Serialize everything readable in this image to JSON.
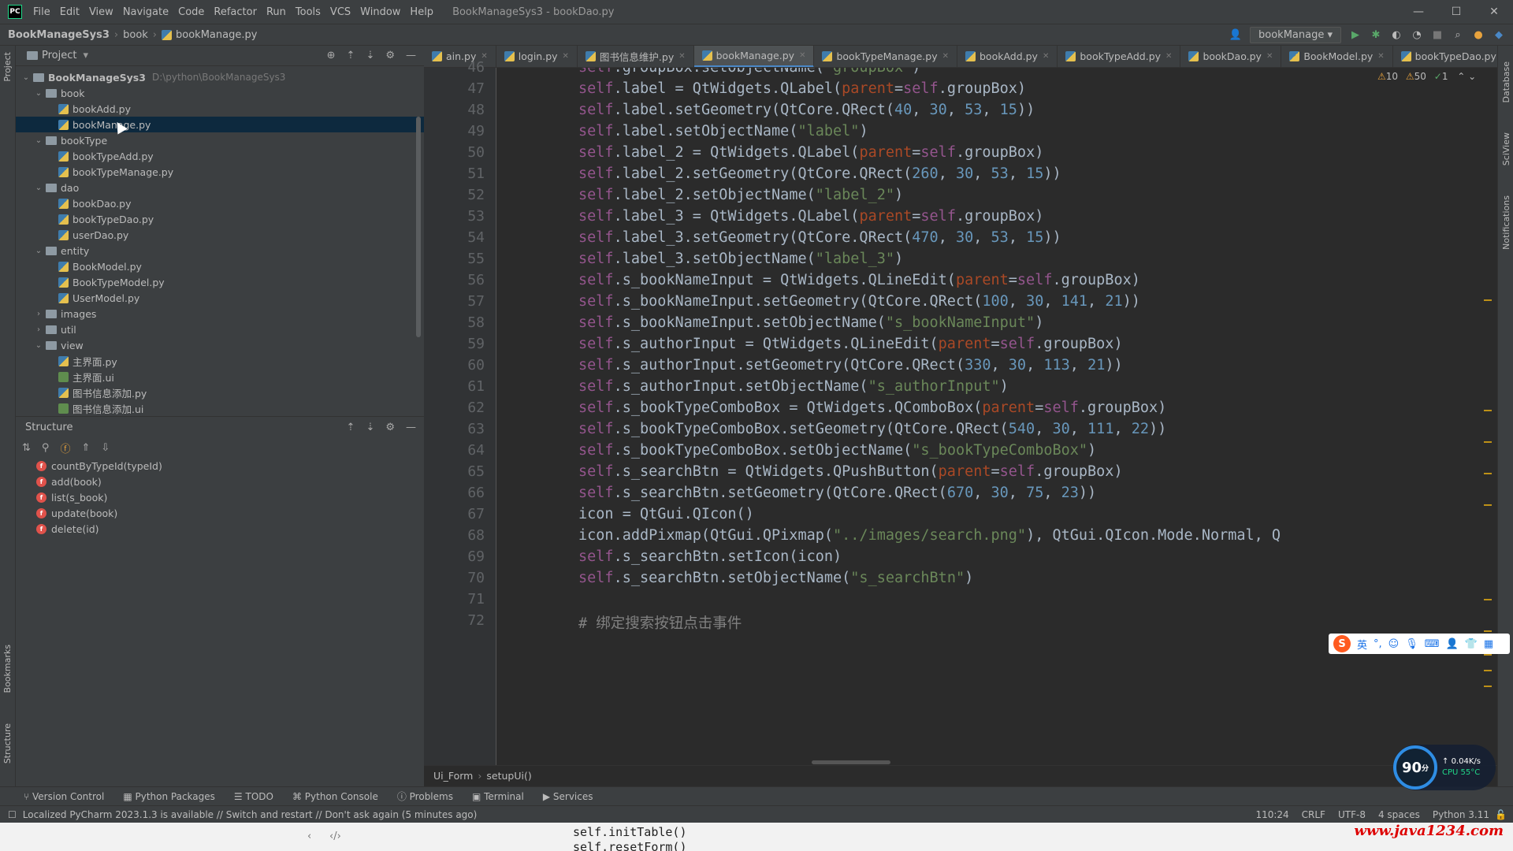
{
  "app": {
    "logo": "PC",
    "window_title": "BookManageSys3 - bookDao.py",
    "menu": [
      "File",
      "Edit",
      "View",
      "Navigate",
      "Code",
      "Refactor",
      "Run",
      "Tools",
      "VCS",
      "Window",
      "Help"
    ]
  },
  "navbar": {
    "crumbs": [
      "BookManageSys3",
      "book",
      "bookManage.py"
    ],
    "run_config": "bookManage"
  },
  "left_stripe": {
    "project": "Project",
    "bookmarks": "Bookmarks",
    "structure": "Structure"
  },
  "right_stripe": {
    "database": "Database",
    "sciview": "SciView",
    "notifications": "Notifications"
  },
  "project_panel": {
    "title": "Project",
    "root_name": "BookManageSys3",
    "root_path": "D:\\python\\BookManageSys3",
    "tree": [
      {
        "label": "book",
        "type": "folder",
        "open": true
      },
      {
        "label": "bookAdd.py",
        "type": "py"
      },
      {
        "label": "bookManage.py",
        "type": "py",
        "selected": true
      },
      {
        "label": "bookType",
        "type": "folder",
        "open": true
      },
      {
        "label": "bookTypeAdd.py",
        "type": "py"
      },
      {
        "label": "bookTypeManage.py",
        "type": "py"
      },
      {
        "label": "dao",
        "type": "folder",
        "open": true
      },
      {
        "label": "bookDao.py",
        "type": "py"
      },
      {
        "label": "bookTypeDao.py",
        "type": "py"
      },
      {
        "label": "userDao.py",
        "type": "py"
      },
      {
        "label": "entity",
        "type": "folder",
        "open": true
      },
      {
        "label": "BookModel.py",
        "type": "py"
      },
      {
        "label": "BookTypeModel.py",
        "type": "py"
      },
      {
        "label": "UserModel.py",
        "type": "py"
      },
      {
        "label": "images",
        "type": "folder",
        "open": false
      },
      {
        "label": "util",
        "type": "folder",
        "open": false
      },
      {
        "label": "view",
        "type": "folder",
        "open": true
      },
      {
        "label": "主界面.py",
        "type": "py"
      },
      {
        "label": "主界面.ui",
        "type": "ui"
      },
      {
        "label": "图书信息添加.py",
        "type": "py"
      },
      {
        "label": "图书信息添加.ui",
        "type": "ui"
      }
    ]
  },
  "structure_panel": {
    "title": "Structure",
    "items": [
      "countByTypeId(typeId)",
      "add(book)",
      "list(s_book)",
      "update(book)",
      "delete(id)"
    ]
  },
  "tabs": [
    {
      "label": "ain.py",
      "active": false
    },
    {
      "label": "login.py",
      "active": false
    },
    {
      "label": "图书信息维护.py",
      "active": false
    },
    {
      "label": "bookManage.py",
      "active": true
    },
    {
      "label": "bookTypeManage.py",
      "active": false
    },
    {
      "label": "bookAdd.py",
      "active": false
    },
    {
      "label": "bookTypeAdd.py",
      "active": false
    },
    {
      "label": "bookDao.py",
      "active": false
    },
    {
      "label": "BookModel.py",
      "active": false
    },
    {
      "label": "bookTypeDao.py",
      "active": false
    }
  ],
  "inspections": {
    "warnings": "10",
    "weak_warnings": "50",
    "typos": "1"
  },
  "code": {
    "first_line": 46,
    "lines": [
      "self.groupBox.setObjectName(\"groupBox\")",
      "self.label = QtWidgets.QLabel(parent=self.groupBox)",
      "self.label.setGeometry(QtCore.QRect(40, 30, 53, 15))",
      "self.label.setObjectName(\"label\")",
      "self.label_2 = QtWidgets.QLabel(parent=self.groupBox)",
      "self.label_2.setGeometry(QtCore.QRect(260, 30, 53, 15))",
      "self.label_2.setObjectName(\"label_2\")",
      "self.label_3 = QtWidgets.QLabel(parent=self.groupBox)",
      "self.label_3.setGeometry(QtCore.QRect(470, 30, 53, 15))",
      "self.label_3.setObjectName(\"label_3\")",
      "self.s_bookNameInput = QtWidgets.QLineEdit(parent=self.groupBox)",
      "self.s_bookNameInput.setGeometry(QtCore.QRect(100, 30, 141, 21))",
      "self.s_bookNameInput.setObjectName(\"s_bookNameInput\")",
      "self.s_authorInput = QtWidgets.QLineEdit(parent=self.groupBox)",
      "self.s_authorInput.setGeometry(QtCore.QRect(330, 30, 113, 21))",
      "self.s_authorInput.setObjectName(\"s_authorInput\")",
      "self.s_bookTypeComboBox = QtWidgets.QComboBox(parent=self.groupBox)",
      "self.s_bookTypeComboBox.setGeometry(QtCore.QRect(540, 30, 111, 22))",
      "self.s_bookTypeComboBox.setObjectName(\"s_bookTypeComboBox\")",
      "self.s_searchBtn = QtWidgets.QPushButton(parent=self.groupBox)",
      "self.s_searchBtn.setGeometry(QtCore.QRect(670, 30, 75, 23))",
      "icon = QtGui.QIcon()",
      "icon.addPixmap(QtGui.QPixmap(\"../images/search.png\"), QtGui.QIcon.Mode.Normal, Q",
      "self.s_searchBtn.setIcon(icon)",
      "self.s_searchBtn.setObjectName(\"s_searchBtn\")",
      "",
      "# 绑定搜索按钮点击事件"
    ]
  },
  "editor_breadcrumb": [
    "Ui_Form",
    "setupUi()"
  ],
  "tool_windows": [
    "Version Control",
    "Python Packages",
    "TODO",
    "Python Console",
    "Problems",
    "Terminal",
    "Services"
  ],
  "status": {
    "message": "Localized PyCharm 2023.1.3 is available // Switch and restart // Don't ask again (5 minutes ago)",
    "position": "110:24",
    "line_sep": "CRLF",
    "encoding": "UTF-8",
    "indent": "4 spaces",
    "interpreter": "Python 3.11"
  },
  "overlay": {
    "code1": "self.initTable()",
    "code2": "self.resetForm()",
    "watermark": "www.java1234.com"
  },
  "ime": {
    "lang": "英"
  },
  "speed_widget": {
    "score": "90",
    "unit": "分",
    "net": "0.04K/s",
    "cpu": "CPU 55°C"
  }
}
